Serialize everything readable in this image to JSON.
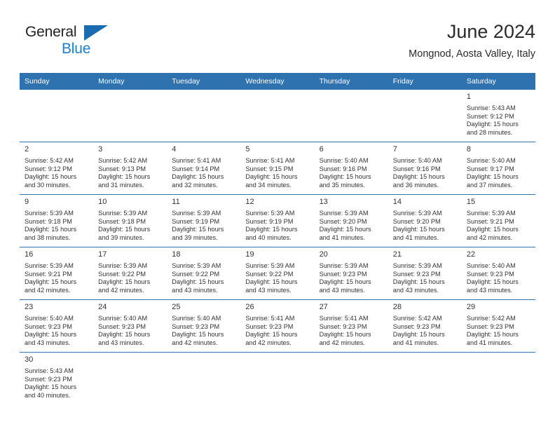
{
  "brand": {
    "name_part1": "General",
    "name_part2": "Blue",
    "triangle_color": "#1b6bb0",
    "blue_text_color": "#1b7fd4"
  },
  "header": {
    "title": "June 2024",
    "subtitle": "Mongnod, Aosta Valley, Italy"
  },
  "theme": {
    "header_blue": "#2e72b0",
    "band_gray": "#f0f0f0",
    "text": "#333333"
  },
  "calendar": {
    "weekday_headers": [
      "Sunday",
      "Monday",
      "Tuesday",
      "Wednesday",
      "Thursday",
      "Friday",
      "Saturday"
    ],
    "weeks": [
      [
        {
          "day": "",
          "lines": []
        },
        {
          "day": "",
          "lines": []
        },
        {
          "day": "",
          "lines": []
        },
        {
          "day": "",
          "lines": []
        },
        {
          "day": "",
          "lines": []
        },
        {
          "day": "",
          "lines": []
        },
        {
          "day": "1",
          "sunrise": "Sunrise: 5:43 AM",
          "sunset": "Sunset: 9:12 PM",
          "daylight1": "Daylight: 15 hours",
          "daylight2": "and 28 minutes."
        }
      ],
      [
        {
          "day": "2",
          "sunrise": "Sunrise: 5:42 AM",
          "sunset": "Sunset: 9:12 PM",
          "daylight1": "Daylight: 15 hours",
          "daylight2": "and 30 minutes."
        },
        {
          "day": "3",
          "sunrise": "Sunrise: 5:42 AM",
          "sunset": "Sunset: 9:13 PM",
          "daylight1": "Daylight: 15 hours",
          "daylight2": "and 31 minutes."
        },
        {
          "day": "4",
          "sunrise": "Sunrise: 5:41 AM",
          "sunset": "Sunset: 9:14 PM",
          "daylight1": "Daylight: 15 hours",
          "daylight2": "and 32 minutes."
        },
        {
          "day": "5",
          "sunrise": "Sunrise: 5:41 AM",
          "sunset": "Sunset: 9:15 PM",
          "daylight1": "Daylight: 15 hours",
          "daylight2": "and 34 minutes."
        },
        {
          "day": "6",
          "sunrise": "Sunrise: 5:40 AM",
          "sunset": "Sunset: 9:16 PM",
          "daylight1": "Daylight: 15 hours",
          "daylight2": "and 35 minutes."
        },
        {
          "day": "7",
          "sunrise": "Sunrise: 5:40 AM",
          "sunset": "Sunset: 9:16 PM",
          "daylight1": "Daylight: 15 hours",
          "daylight2": "and 36 minutes."
        },
        {
          "day": "8",
          "sunrise": "Sunrise: 5:40 AM",
          "sunset": "Sunset: 9:17 PM",
          "daylight1": "Daylight: 15 hours",
          "daylight2": "and 37 minutes."
        }
      ],
      [
        {
          "day": "9",
          "sunrise": "Sunrise: 5:39 AM",
          "sunset": "Sunset: 9:18 PM",
          "daylight1": "Daylight: 15 hours",
          "daylight2": "and 38 minutes."
        },
        {
          "day": "10",
          "sunrise": "Sunrise: 5:39 AM",
          "sunset": "Sunset: 9:18 PM",
          "daylight1": "Daylight: 15 hours",
          "daylight2": "and 39 minutes."
        },
        {
          "day": "11",
          "sunrise": "Sunrise: 5:39 AM",
          "sunset": "Sunset: 9:19 PM",
          "daylight1": "Daylight: 15 hours",
          "daylight2": "and 39 minutes."
        },
        {
          "day": "12",
          "sunrise": "Sunrise: 5:39 AM",
          "sunset": "Sunset: 9:19 PM",
          "daylight1": "Daylight: 15 hours",
          "daylight2": "and 40 minutes."
        },
        {
          "day": "13",
          "sunrise": "Sunrise: 5:39 AM",
          "sunset": "Sunset: 9:20 PM",
          "daylight1": "Daylight: 15 hours",
          "daylight2": "and 41 minutes."
        },
        {
          "day": "14",
          "sunrise": "Sunrise: 5:39 AM",
          "sunset": "Sunset: 9:20 PM",
          "daylight1": "Daylight: 15 hours",
          "daylight2": "and 41 minutes."
        },
        {
          "day": "15",
          "sunrise": "Sunrise: 5:39 AM",
          "sunset": "Sunset: 9:21 PM",
          "daylight1": "Daylight: 15 hours",
          "daylight2": "and 42 minutes."
        }
      ],
      [
        {
          "day": "16",
          "sunrise": "Sunrise: 5:39 AM",
          "sunset": "Sunset: 9:21 PM",
          "daylight1": "Daylight: 15 hours",
          "daylight2": "and 42 minutes."
        },
        {
          "day": "17",
          "sunrise": "Sunrise: 5:39 AM",
          "sunset": "Sunset: 9:22 PM",
          "daylight1": "Daylight: 15 hours",
          "daylight2": "and 42 minutes."
        },
        {
          "day": "18",
          "sunrise": "Sunrise: 5:39 AM",
          "sunset": "Sunset: 9:22 PM",
          "daylight1": "Daylight: 15 hours",
          "daylight2": "and 43 minutes."
        },
        {
          "day": "19",
          "sunrise": "Sunrise: 5:39 AM",
          "sunset": "Sunset: 9:22 PM",
          "daylight1": "Daylight: 15 hours",
          "daylight2": "and 43 minutes."
        },
        {
          "day": "20",
          "sunrise": "Sunrise: 5:39 AM",
          "sunset": "Sunset: 9:23 PM",
          "daylight1": "Daylight: 15 hours",
          "daylight2": "and 43 minutes."
        },
        {
          "day": "21",
          "sunrise": "Sunrise: 5:39 AM",
          "sunset": "Sunset: 9:23 PM",
          "daylight1": "Daylight: 15 hours",
          "daylight2": "and 43 minutes."
        },
        {
          "day": "22",
          "sunrise": "Sunrise: 5:40 AM",
          "sunset": "Sunset: 9:23 PM",
          "daylight1": "Daylight: 15 hours",
          "daylight2": "and 43 minutes."
        }
      ],
      [
        {
          "day": "23",
          "sunrise": "Sunrise: 5:40 AM",
          "sunset": "Sunset: 9:23 PM",
          "daylight1": "Daylight: 15 hours",
          "daylight2": "and 43 minutes."
        },
        {
          "day": "24",
          "sunrise": "Sunrise: 5:40 AM",
          "sunset": "Sunset: 9:23 PM",
          "daylight1": "Daylight: 15 hours",
          "daylight2": "and 43 minutes."
        },
        {
          "day": "25",
          "sunrise": "Sunrise: 5:40 AM",
          "sunset": "Sunset: 9:23 PM",
          "daylight1": "Daylight: 15 hours",
          "daylight2": "and 42 minutes."
        },
        {
          "day": "26",
          "sunrise": "Sunrise: 5:41 AM",
          "sunset": "Sunset: 9:23 PM",
          "daylight1": "Daylight: 15 hours",
          "daylight2": "and 42 minutes."
        },
        {
          "day": "27",
          "sunrise": "Sunrise: 5:41 AM",
          "sunset": "Sunset: 9:23 PM",
          "daylight1": "Daylight: 15 hours",
          "daylight2": "and 42 minutes."
        },
        {
          "day": "28",
          "sunrise": "Sunrise: 5:42 AM",
          "sunset": "Sunset: 9:23 PM",
          "daylight1": "Daylight: 15 hours",
          "daylight2": "and 41 minutes."
        },
        {
          "day": "29",
          "sunrise": "Sunrise: 5:42 AM",
          "sunset": "Sunset: 9:23 PM",
          "daylight1": "Daylight: 15 hours",
          "daylight2": "and 41 minutes."
        }
      ],
      [
        {
          "day": "30",
          "sunrise": "Sunrise: 5:43 AM",
          "sunset": "Sunset: 9:23 PM",
          "daylight1": "Daylight: 15 hours",
          "daylight2": "and 40 minutes."
        },
        {
          "day": "",
          "lines": []
        },
        {
          "day": "",
          "lines": []
        },
        {
          "day": "",
          "lines": []
        },
        {
          "day": "",
          "lines": []
        },
        {
          "day": "",
          "lines": []
        },
        {
          "day": "",
          "lines": []
        }
      ]
    ]
  }
}
